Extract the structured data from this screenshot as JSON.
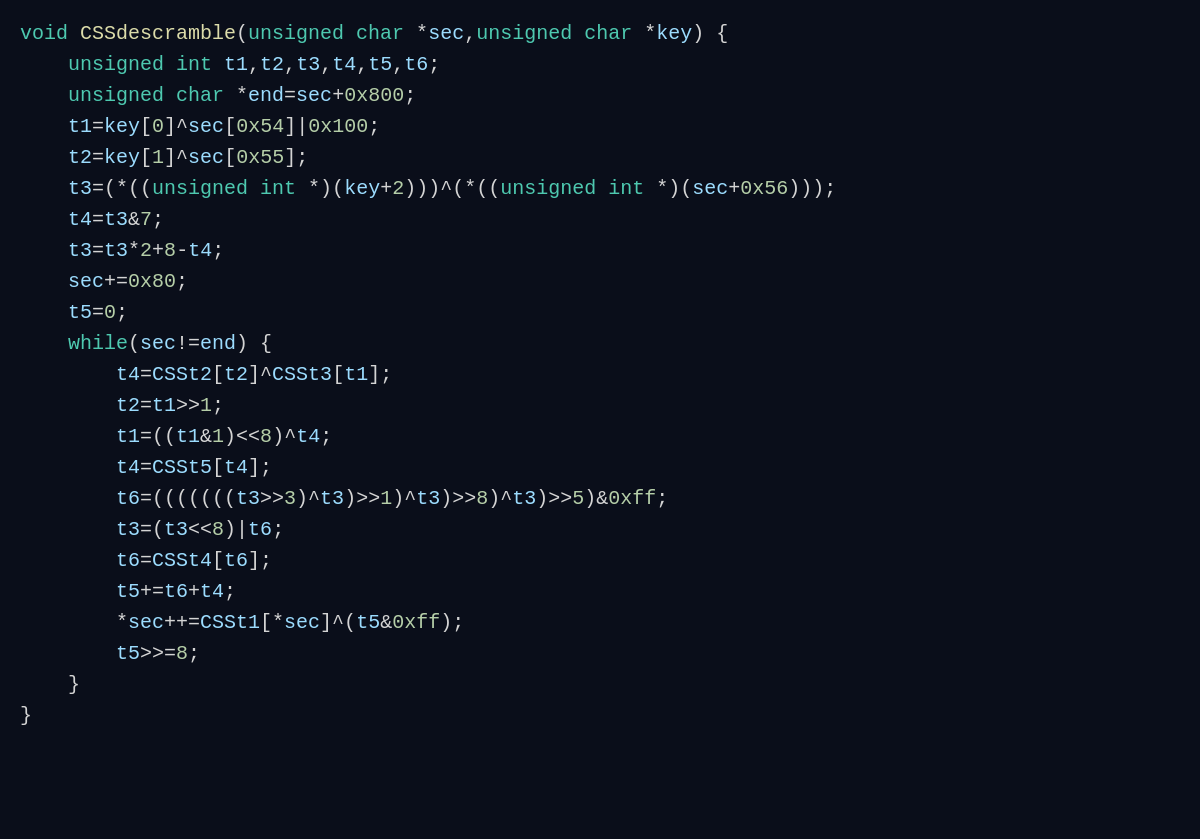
{
  "code": {
    "background": "#0a0e1a",
    "lines": [
      "void CSSdescramble(unsigned char *sec,unsigned char *key) {",
      "    unsigned int t1,t2,t3,t4,t5,t6;",
      "    unsigned char *end=sec+0x800;",
      "    t1=key[0]^sec[0x54]|0x100;",
      "    t2=key[1]^sec[0x55];",
      "    t3=(*((unsigned int *)(key+2)))^(*((unsigned int *)(sec+0x56)));",
      "    t4=t3&7;",
      "    t3=t3*2+8-t4;",
      "    sec+=0x80;",
      "    t5=0;",
      "    while(sec!=end) {",
      "        t4=CSSt2[t2]^CSSt3[t1];",
      "        t2=t1>>1;",
      "        t1=((t1&1)<<8)^t4;",
      "        t4=CSSt5[t4];",
      "        t6=(((((((t3>>3)^t3)>>1)^t3)>>8)^t3)>>5)&0xff;",
      "        t3=(t3<<8)|t6;",
      "        t6=CSSt4[t6];",
      "        t5+=t6+t4;",
      "        *sec++=CSSt1[*sec]^(t5&0xff);",
      "        t5>>=8;",
      "    }",
      "}"
    ]
  }
}
